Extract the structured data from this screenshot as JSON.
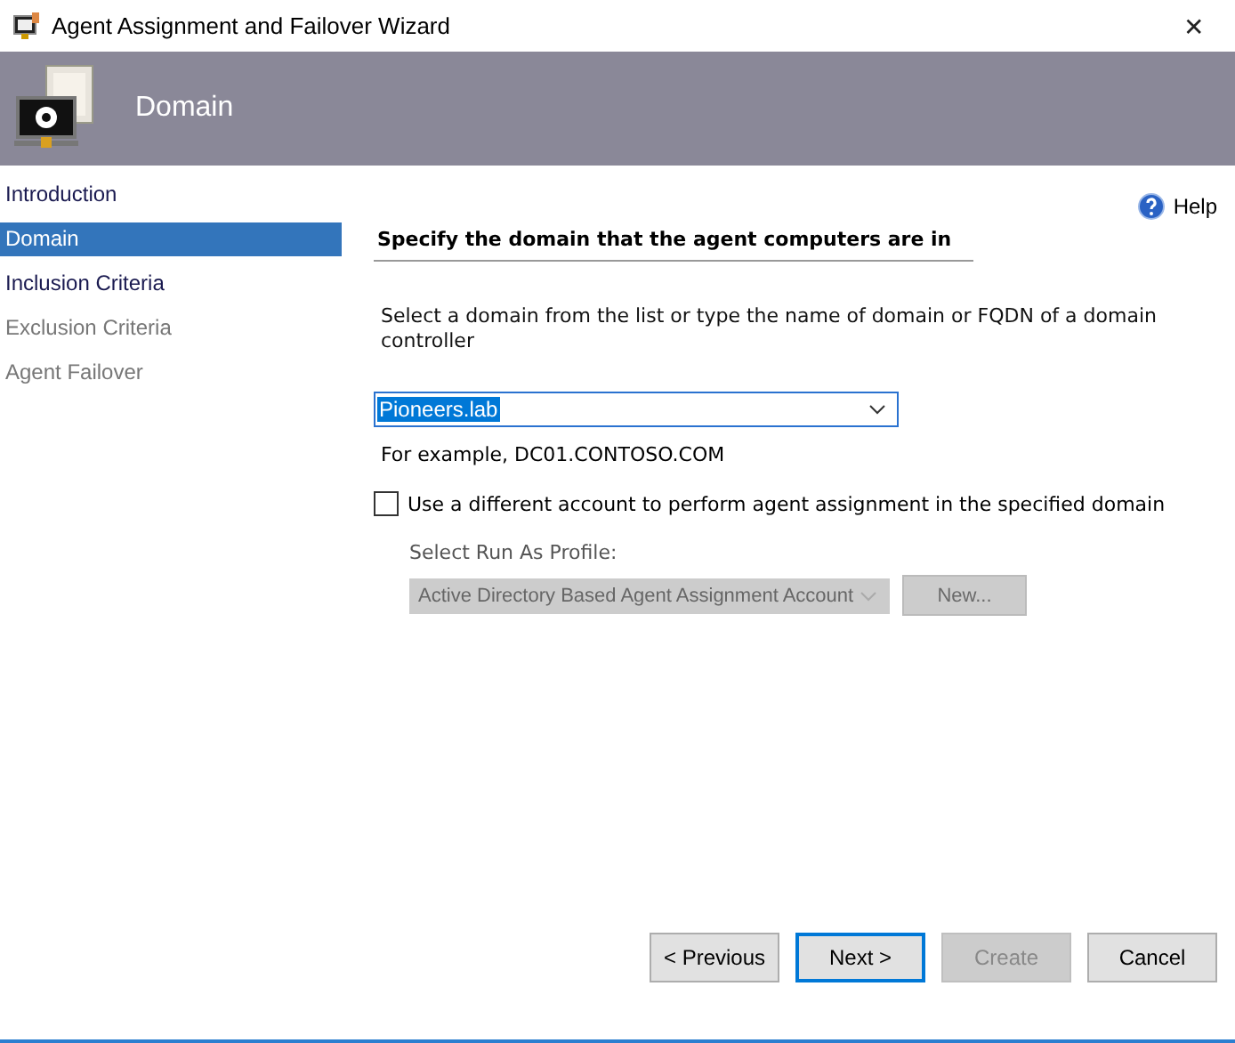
{
  "window": {
    "title": "Agent Assignment and Failover Wizard",
    "close": "✕"
  },
  "header": {
    "title": "Domain"
  },
  "steps": [
    {
      "label": "Introduction",
      "selected": false,
      "disabled": false
    },
    {
      "label": "Domain",
      "selected": true,
      "disabled": false
    },
    {
      "label": "Inclusion Criteria",
      "selected": false,
      "disabled": false
    },
    {
      "label": "Exclusion Criteria",
      "selected": false,
      "disabled": true
    },
    {
      "label": "Agent Failover",
      "selected": false,
      "disabled": true
    }
  ],
  "help": {
    "label": "Help"
  },
  "section_title": "Specify the domain that the agent computers are in",
  "instruction": "Select a domain from the list or type the name of domain or FQDN of a domain controller",
  "domain": {
    "value": "Pioneers.lab"
  },
  "example": "For example, DC01.CONTOSO.COM",
  "different_account": {
    "label": "Use a different account to perform agent assignment in the specified domain",
    "checked": false
  },
  "profile": {
    "label": "Select Run As Profile:",
    "value": "Active Directory Based Agent Assignment Account",
    "disabled": true,
    "new_button": "New..."
  },
  "buttons": [
    {
      "label": "< Previous",
      "disabled": false,
      "default": false
    },
    {
      "label": "Next >",
      "disabled": false,
      "default": true
    },
    {
      "label": "Create",
      "disabled": true,
      "default": false
    },
    {
      "label": "Cancel",
      "disabled": false,
      "default": false
    }
  ]
}
